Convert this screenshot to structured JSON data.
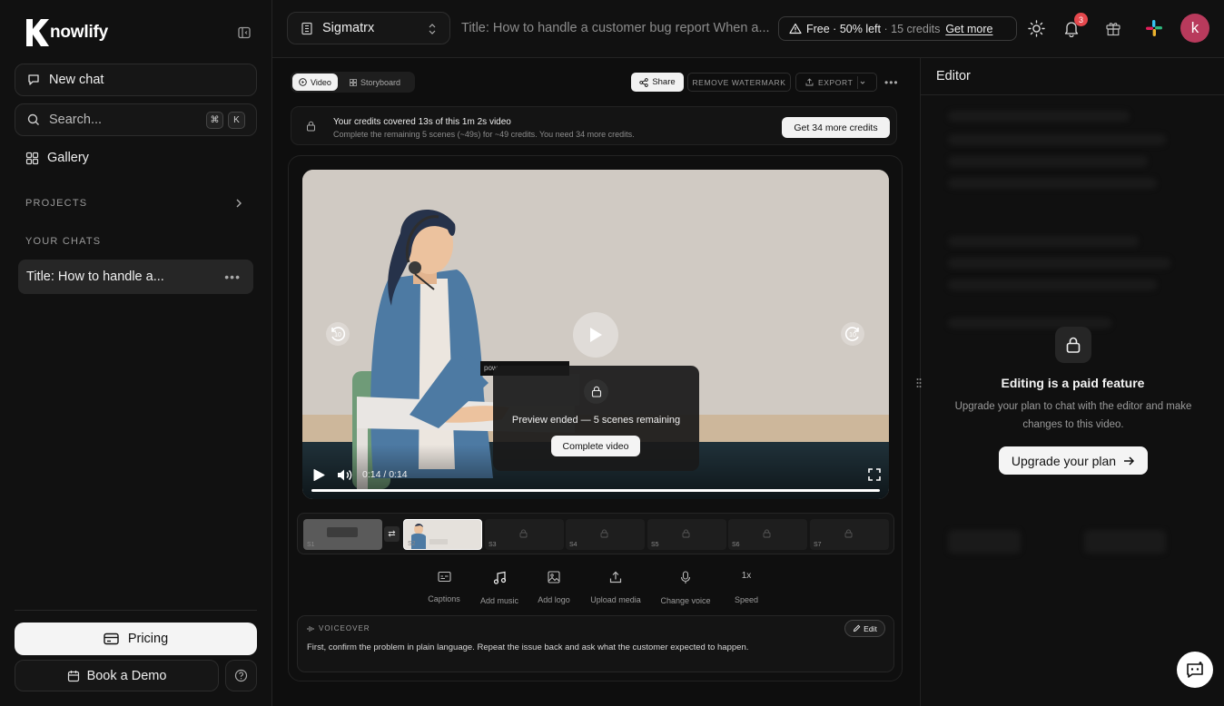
{
  "brand": {
    "name": "nowlify"
  },
  "sidebar": {
    "new_chat": "New chat",
    "search_placeholder": "Search...",
    "search_keys": [
      "⌘",
      "K"
    ],
    "gallery": "Gallery",
    "projects_heading": "PROJECTS",
    "chats_heading": "YOUR CHATS",
    "chats": [
      {
        "title": "Title: How to handle a..."
      }
    ],
    "pricing": "Pricing",
    "book_demo": "Book a Demo"
  },
  "topbar": {
    "workspace": "Sigmatrx",
    "document_title": "Title: How to handle a customer bug report When a...",
    "plan": "Free ·",
    "usage": "50% left",
    "credits": "· 15 credits",
    "get_more": "Get more",
    "notification_count": "3",
    "avatar_initial": "k"
  },
  "toolbar": {
    "tabs": [
      {
        "label": "Video",
        "active": true
      },
      {
        "label": "Storyboard",
        "active": false
      }
    ],
    "share": "Share",
    "remove_watermark": "REMOVE WATERMARK",
    "export": "EXPORT"
  },
  "notice": {
    "title": "Your credits covered 13s of this 1m 2s video",
    "detail": "Complete the remaining 5 scenes (~49s) for ~49 credits. You need 34 more credits.",
    "button": "Get 34 more credits"
  },
  "player": {
    "overlay_text": "Preview ended — 5 scenes remaining",
    "overlay_button": "Complete video",
    "time": "0:14 / 0:14",
    "watermark_text": "pow",
    "progress": 1.0
  },
  "scenes": [
    {
      "label": "S1",
      "locked": false
    },
    {
      "label": "S2",
      "locked": false
    },
    {
      "label": "S3",
      "locked": true
    },
    {
      "label": "S4",
      "locked": true
    },
    {
      "label": "S5",
      "locked": true
    },
    {
      "label": "S6",
      "locked": true
    },
    {
      "label": "S7",
      "locked": true
    }
  ],
  "tools": [
    {
      "label": "Captions",
      "icon": "captions-icon"
    },
    {
      "label": "Add music",
      "icon": "music-icon"
    },
    {
      "label": "Add logo",
      "icon": "image-icon"
    },
    {
      "label": "Upload media",
      "icon": "upload-icon"
    },
    {
      "label": "Change voice",
      "icon": "mic-icon"
    },
    {
      "label": "Speed",
      "icon": "speed-icon",
      "value": "1x"
    }
  ],
  "voiceover": {
    "heading": "VOICEOVER",
    "edit": "Edit",
    "text": "First, confirm the problem in plain language. Repeat the issue back and ask what the customer expected to happen."
  },
  "editor": {
    "title": "Editor",
    "locked_title": "Editing is a paid feature",
    "locked_desc": "Upgrade your plan to chat with the editor and make changes to this video.",
    "upgrade_button": "Upgrade your plan"
  },
  "colors": {
    "accent_avatar": "#b83a5c",
    "badge": "#e5484d",
    "background": "#0c0c0c"
  }
}
